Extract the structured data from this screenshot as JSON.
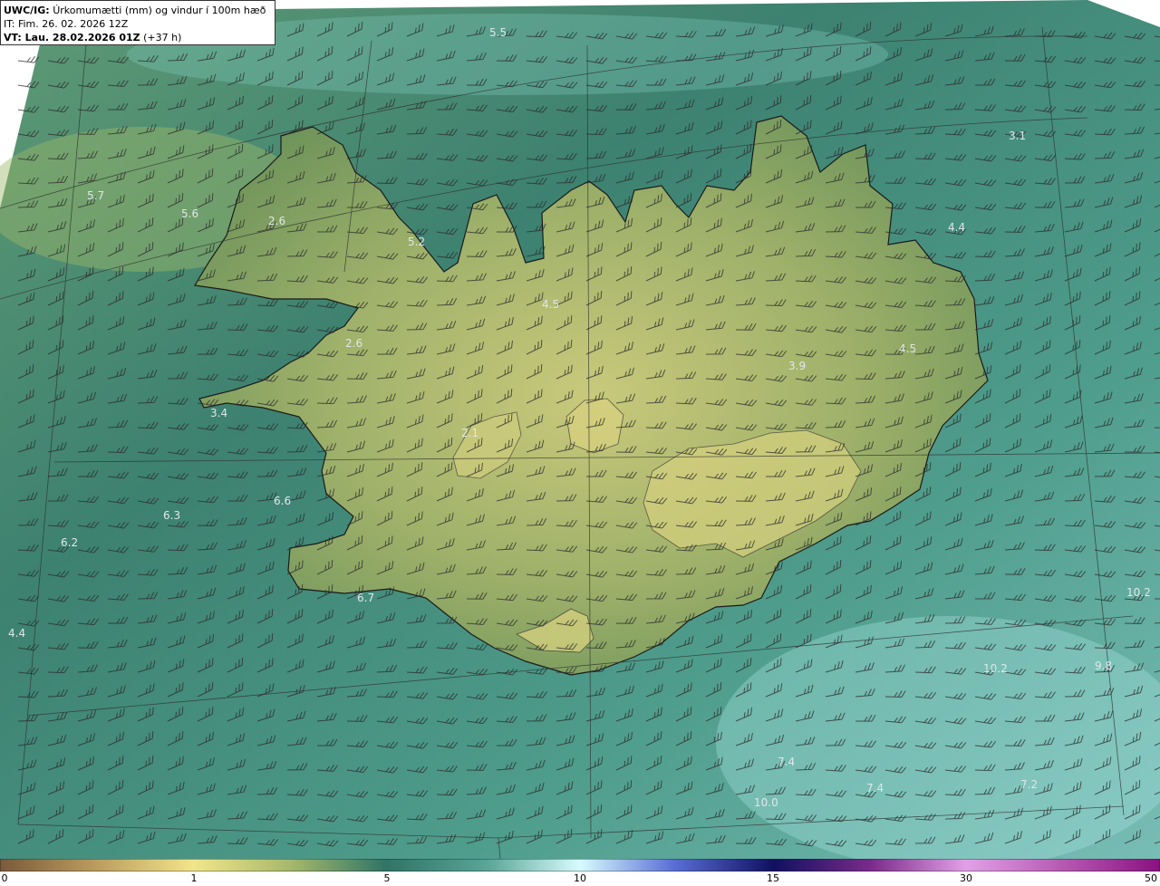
{
  "title": {
    "product": "UWC/IG:",
    "description": "Úrkomumætti (mm) og vindur í 100m hæð",
    "init_time": "IT: Fim. 26. 02. 2026 12Z",
    "valid_prefix": "VT: Lau. 28.02.2026 01Z",
    "valid_suffix": "(+37 h)"
  },
  "colors": {
    "ocean_dark": "#2f7467",
    "ocean_mid": "#4f9a8a",
    "ocean_light": "#8fd3cf",
    "land_mid": "#7f9f5e",
    "land_light": "#c7c97a",
    "coast": "#1a1a1a",
    "grid": "#333333"
  },
  "value_labels": [
    {
      "text": "5.7"
    },
    {
      "text": "5.6"
    },
    {
      "text": "2.6"
    },
    {
      "text": "5.2"
    },
    {
      "text": "4.5"
    },
    {
      "text": "3.9"
    },
    {
      "text": "4.5"
    },
    {
      "text": "4.4"
    },
    {
      "text": "3.1"
    },
    {
      "text": "2.6"
    },
    {
      "text": "3.4"
    },
    {
      "text": "2.1"
    },
    {
      "text": "6.6"
    },
    {
      "text": "6.3"
    },
    {
      "text": "6.2"
    },
    {
      "text": "6.7"
    },
    {
      "text": "4.4"
    },
    {
      "text": "10.2"
    },
    {
      "text": "10.2"
    },
    {
      "text": "7.4"
    },
    {
      "text": "7.4"
    },
    {
      "text": "10.0"
    },
    {
      "text": "7.2"
    },
    {
      "text": "9.8"
    },
    {
      "text": "5.5"
    }
  ],
  "colorbar": {
    "ticks": [
      "0",
      "1",
      "5",
      "10",
      "15",
      "30",
      "50"
    ]
  }
}
